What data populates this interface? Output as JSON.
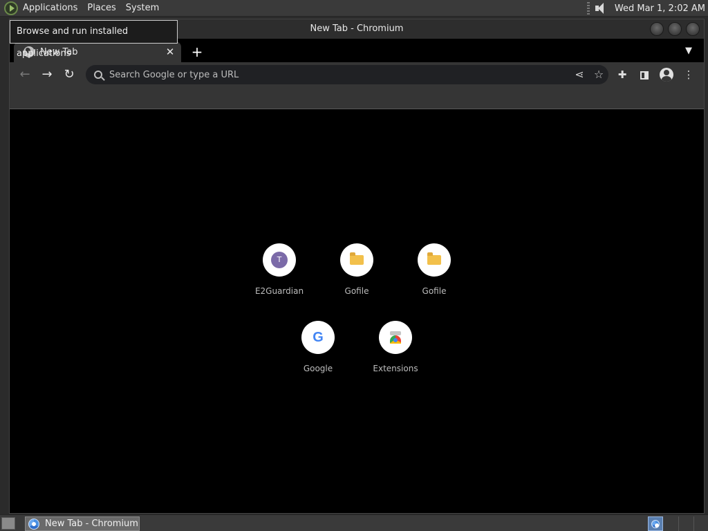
{
  "top_panel": {
    "menus": [
      "Applications",
      "Places",
      "System"
    ],
    "clock": "Wed Mar  1,  2:02 AM"
  },
  "tooltip": {
    "text": "Browse and run installed applications"
  },
  "window": {
    "title": "New Tab - Chromium",
    "tab": {
      "label": "New Tab"
    },
    "omnibox": {
      "placeholder": "Search Google or type a URL"
    }
  },
  "shortcuts": [
    {
      "label": "E2Guardian",
      "icon": "letter-T",
      "letter": "T"
    },
    {
      "label": "Gofile",
      "icon": "folder"
    },
    {
      "label": "Gofile",
      "icon": "folder"
    },
    {
      "label": "Google",
      "icon": "google-G",
      "letter": "G"
    },
    {
      "label": "Extensions",
      "icon": "chrome-web-store"
    }
  ],
  "taskbar": {
    "task_label": "New Tab - Chromium"
  }
}
